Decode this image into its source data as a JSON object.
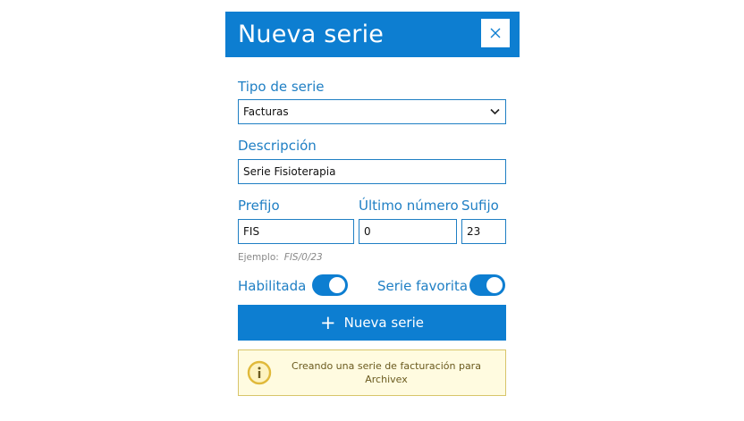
{
  "header": {
    "title": "Nueva serie"
  },
  "form": {
    "tipo_label": "Tipo de serie",
    "tipo_value": "Facturas",
    "descripcion_label": "Descripción",
    "descripcion_value": "Serie Fisioterapia",
    "prefijo_label": "Prefijo",
    "prefijo_value": "FIS",
    "ultimo_numero_label": "Último número",
    "ultimo_numero_value": "0",
    "sufijo_label": "Sufijo",
    "sufijo_value": "23",
    "ejemplo_label": "Ejemplo:",
    "ejemplo_value": "FIS/0/23",
    "habilitada_label": "Habilitada",
    "habilitada_on": true,
    "favorita_label": "Serie favorita",
    "favorita_on": true
  },
  "actions": {
    "plus_glyph": "+",
    "submit_label": "Nueva serie"
  },
  "info": {
    "text": "Creando una serie de facturación para Archivex"
  },
  "colors": {
    "accent": "#0d7ed1",
    "label": "#1f7fc4",
    "info_bg": "#fffbe0",
    "info_border": "#d8c56a"
  },
  "icons": {
    "close": "close-icon",
    "dropdown": "chevron-down-icon",
    "plus": "plus-icon",
    "info": "info-icon"
  }
}
